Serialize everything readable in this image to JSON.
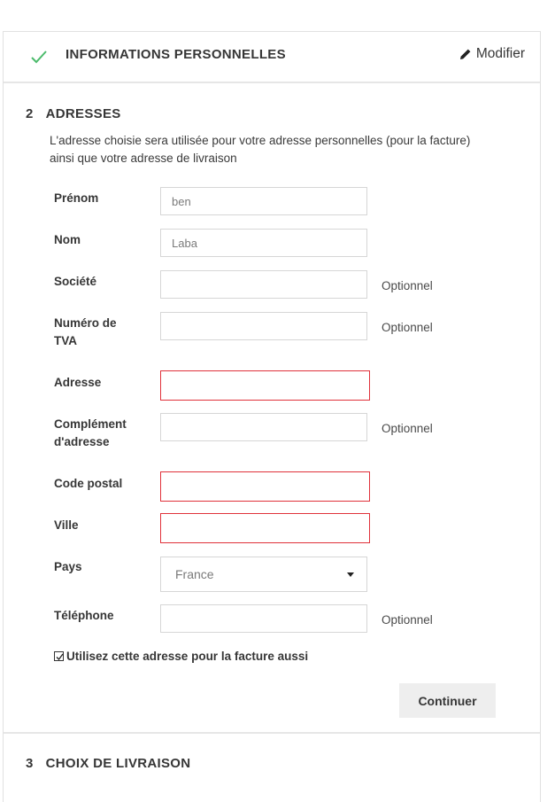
{
  "step1": {
    "title": "INFORMATIONS PERSONNELLES",
    "modify_label": "Modifier",
    "status_color": "#4cbb6c"
  },
  "step2": {
    "number": "2",
    "title": "ADRESSES",
    "intro": "L'adresse choisie sera utilisée pour votre adresse personnelles (pour la facture) ainsi que votre adresse de livraison",
    "optional_label": "Optionnel",
    "fields": {
      "firstname": {
        "label": "Prénom",
        "value": "ben"
      },
      "lastname": {
        "label": "Nom",
        "value": "Laba"
      },
      "company": {
        "label": "Société",
        "value": ""
      },
      "vat": {
        "label": "Numéro de TVA",
        "value": ""
      },
      "address": {
        "label": "Adresse",
        "value": "",
        "error": true
      },
      "address2": {
        "label": "Complément d'adresse",
        "value": ""
      },
      "postcode": {
        "label": "Code postal",
        "value": "",
        "error": true
      },
      "city": {
        "label": "Ville",
        "value": "",
        "error": true
      },
      "country": {
        "label": "Pays",
        "value": "France"
      },
      "phone": {
        "label": "Téléphone",
        "value": ""
      }
    },
    "use_for_invoice": {
      "label": "Utilisez cette adresse pour la facture aussi",
      "checked": true
    },
    "continue_label": "Continuer",
    "error_color": "#e0313a"
  },
  "step3": {
    "number": "3",
    "title": "CHOIX DE LIVRAISON"
  }
}
